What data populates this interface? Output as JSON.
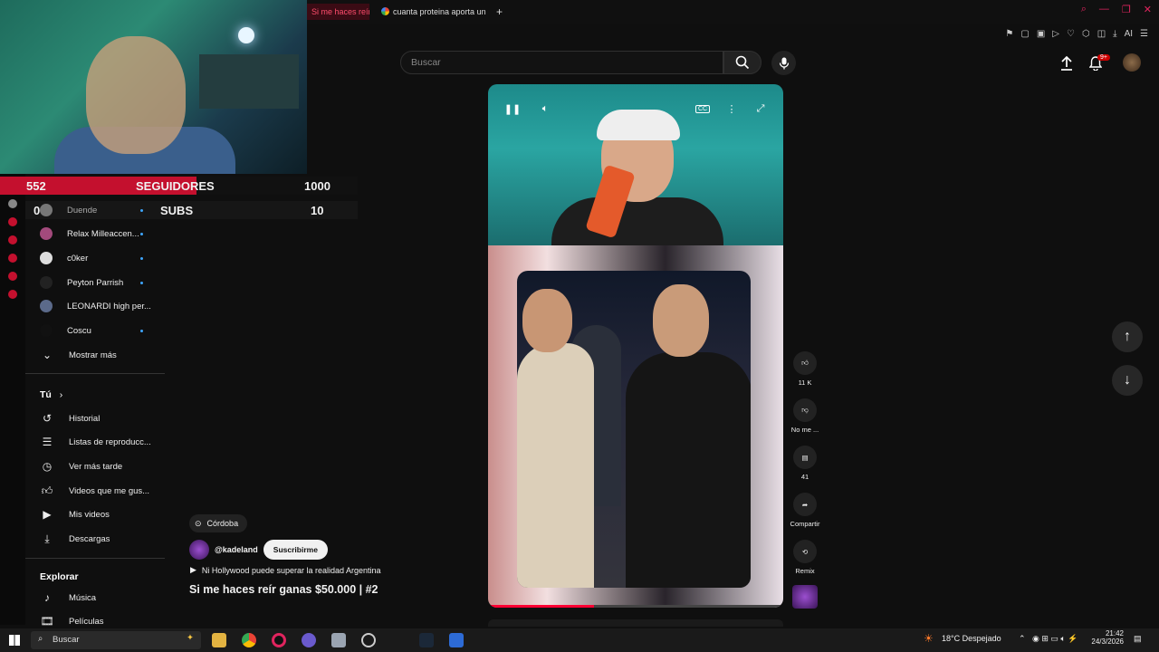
{
  "browser": {
    "tabs": [
      {
        "label": "Si me haces reír",
        "active": true
      },
      {
        "label": "cuanta proteina aporta un",
        "active": false
      }
    ],
    "new_tab": "+",
    "ai_label": "AI"
  },
  "overlay": {
    "followers_current": "552",
    "followers_label": "SEGUIDORES",
    "followers_goal": "1000",
    "subs_current": "0",
    "subs_label": "SUBS",
    "subs_goal": "10"
  },
  "search": {
    "placeholder": "Buscar"
  },
  "notifications": {
    "badge": "9+"
  },
  "sidebar": {
    "subscriptions": [
      {
        "name": "Duende",
        "new": true
      },
      {
        "name": "Relax Milleaccen...",
        "new": true
      },
      {
        "name": "c0ker",
        "new": true
      },
      {
        "name": "Peyton Parrish",
        "new": true
      },
      {
        "name": "LEONARDI high per...",
        "new": false
      },
      {
        "name": "Coscu",
        "new": true
      }
    ],
    "show_more": "Mostrar más",
    "you_heading": "Tú",
    "you_items": [
      "Historial",
      "Listas de reproducc...",
      "Ver más tarde",
      "Videos que me gus...",
      "Mis videos",
      "Descargas"
    ],
    "explore_heading": "Explorar",
    "explore_items": [
      "Música",
      "Películas"
    ]
  },
  "video": {
    "location": "Córdoba",
    "channel": "@kadeland",
    "subscribe_label": "Suscribirme",
    "sound": "Ni Hollywood puede superar la realidad Argentina",
    "title": "Si me haces reír ganas $50.000 | #2",
    "progress": 0.36
  },
  "actions": {
    "likes": "11 K",
    "dislike": "No me ...",
    "comments": "41",
    "share": "Compartir",
    "remix": "Remix"
  },
  "taskbar": {
    "search": "Buscar",
    "weather": "18°C  Despejado",
    "time": "21:42",
    "date": "24/3/2026"
  }
}
